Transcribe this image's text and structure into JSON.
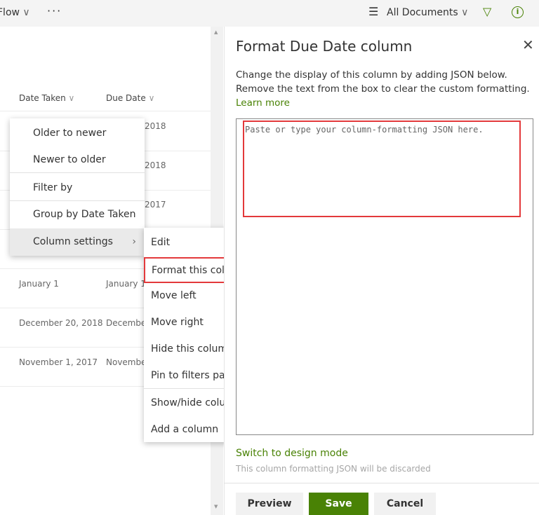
{
  "topbar": {
    "flow": "Flow",
    "more": "···",
    "view": "All Documents"
  },
  "list": {
    "headers": [
      "Date Taken",
      "Due Date"
    ],
    "rows": [
      [
        "",
        "2018"
      ],
      [
        "",
        "2018"
      ],
      [
        "",
        "2017"
      ],
      [
        "",
        ""
      ],
      [
        "January 1",
        "January 1"
      ],
      [
        "December 20, 2018",
        "Decembe"
      ],
      [
        "November 1, 2017",
        "Novembe"
      ]
    ]
  },
  "menu": {
    "items": [
      "Older to newer",
      "Newer to older",
      "Filter by",
      "Group by Date Taken",
      "Column settings"
    ]
  },
  "submenu": {
    "items": [
      "Edit",
      "Format this column",
      "Move left",
      "Move right",
      "Hide this column",
      "Pin to filters pane",
      "Show/hide columns",
      "Add a column"
    ]
  },
  "panel": {
    "title": "Format Due Date column",
    "desc1": "Change the display of this column by adding JSON below.",
    "desc2": "Remove the text from the box to clear the custom formatting.",
    "learn_more": "Learn more",
    "placeholder": "Paste or type your column-formatting JSON here.",
    "switch": "Switch to design mode",
    "note": "This column formatting JSON will be discarded",
    "preview": "Preview",
    "save": "Save",
    "cancel": "Cancel"
  },
  "colors": {
    "accent": "#498205",
    "highlight": "#e3393b"
  }
}
